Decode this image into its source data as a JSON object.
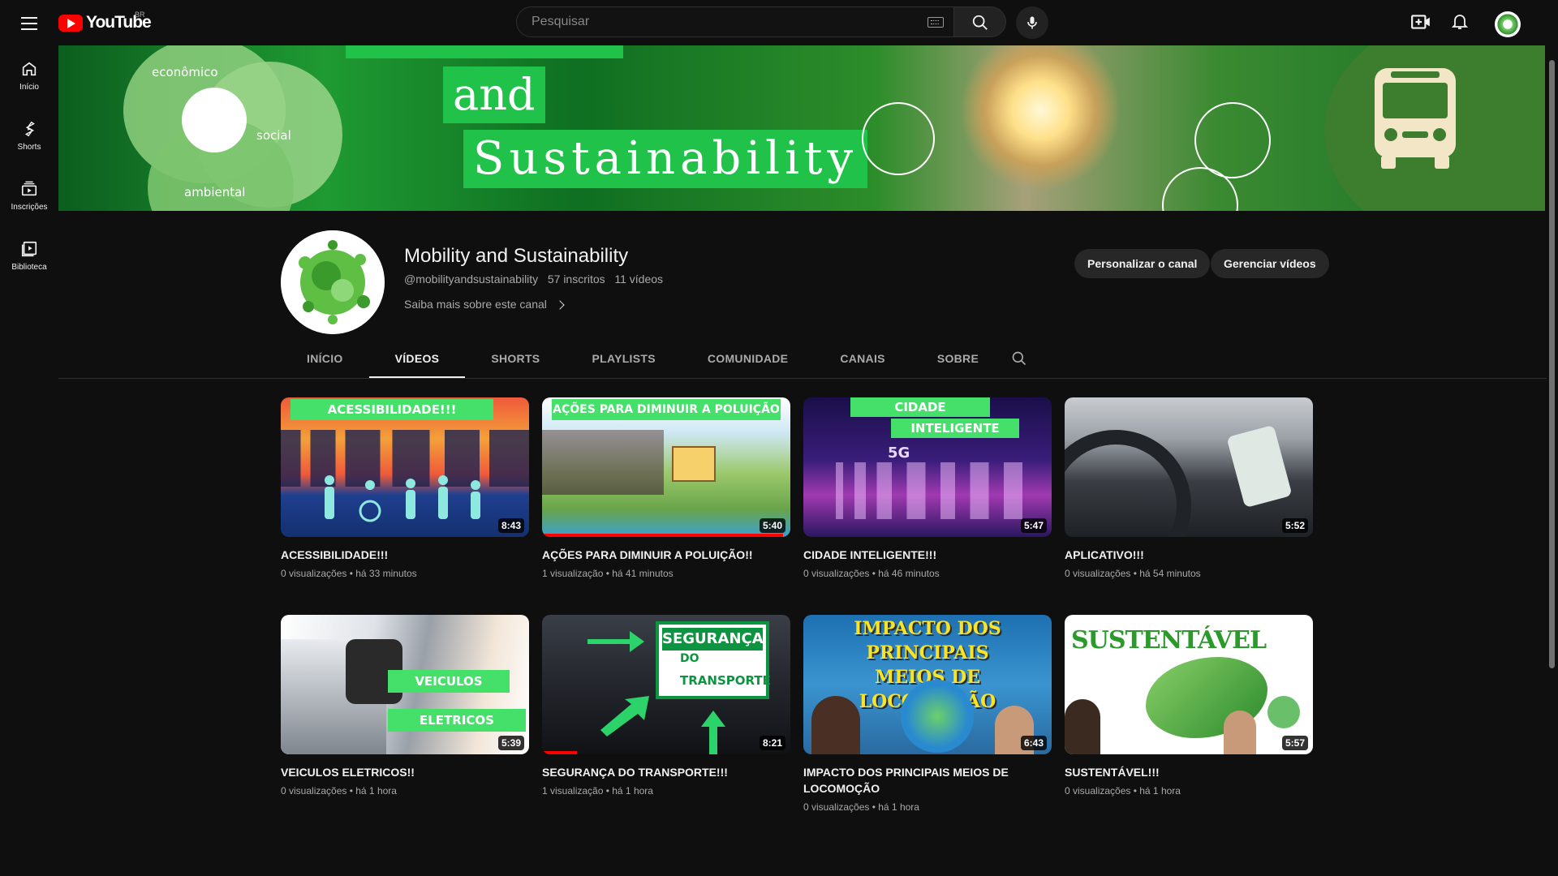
{
  "header": {
    "logo_text": "YouTube",
    "country_code": "BR",
    "search_placeholder": "Pesquisar"
  },
  "sidebar": {
    "items": [
      {
        "label": "Início",
        "icon": "home-icon"
      },
      {
        "label": "Shorts",
        "icon": "shorts-icon"
      },
      {
        "label": "Inscrições",
        "icon": "subscriptions-icon"
      },
      {
        "label": "Biblioteca",
        "icon": "library-icon"
      }
    ]
  },
  "banner": {
    "words": [
      "and",
      "Sustainability"
    ],
    "circle_labels": [
      "econômico",
      "social",
      "ambiental"
    ]
  },
  "channel": {
    "name": "Mobility and Sustainability",
    "handle": "@mobilityandsustainability",
    "subscribers": "57 inscritos",
    "video_count": "11 vídeos",
    "more_link": "Saiba mais sobre este canal",
    "customize_button": "Personalizar o canal",
    "manage_button": "Gerenciar vídeos"
  },
  "tabs": [
    "INÍCIO",
    "VÍDEOS",
    "SHORTS",
    "PLAYLISTS",
    "COMUNIDADE",
    "CANAIS",
    "SOBRE"
  ],
  "active_tab": "VÍDEOS",
  "videos": [
    {
      "title": "ACESSIBILIDADE!!!",
      "views": "0 visualizações",
      "age": "há 33 minutos",
      "duration": "8:43",
      "thumb_text": "ACESSIBILIDADE!!!"
    },
    {
      "title": "AÇÕES PARA DIMINUIR A POLUIÇÃO!!",
      "views": "1 visualização",
      "age": "há 41 minutos",
      "duration": "5:40",
      "thumb_text": "AÇÕES PARA DIMINUIR A POLUIÇÃO",
      "progress": 0.97
    },
    {
      "title": "CIDADE INTELIGENTE!!!",
      "views": "0 visualizações",
      "age": "há 46 minutos",
      "duration": "5:47",
      "thumb_text": [
        "CIDADE",
        "INTELIGENTE",
        "5G"
      ]
    },
    {
      "title": "APLICATIVO!!!",
      "views": "0 visualizações",
      "age": "há 54 minutos",
      "duration": "5:52"
    },
    {
      "title": "VEICULOS ELETRICOS!!",
      "views": "0 visualizações",
      "age": "há 1 hora",
      "duration": "5:39",
      "thumb_text": [
        "VEICULOS",
        "ELETRICOS"
      ]
    },
    {
      "title": "SEGURANÇA DO TRANSPORTE!!!",
      "views": "1 visualização",
      "age": "há 1 hora",
      "duration": "8:21",
      "thumb_text": [
        "SEGURANÇA",
        "DO",
        "TRANSPORTE"
      ],
      "progress": 0.14
    },
    {
      "title": "IMPACTO DOS PRINCIPAIS MEIOS DE LOCOMOÇÃO",
      "views": "0 visualizações",
      "age": "há 1 hora",
      "duration": "6:43",
      "thumb_text": [
        "IMPACTO DOS PRINCIPAIS",
        "MEIOS DE LOCOMOÇÃO"
      ]
    },
    {
      "title": "SUSTENTÁVEL!!!",
      "views": "0 visualizações",
      "age": "há 1 hora",
      "duration": "5:57",
      "thumb_text": "SUSTENTÁVEL"
    }
  ],
  "colors": {
    "background": "#0f0f0f",
    "accent_red": "#ff0000",
    "banner_green": "#21c24a"
  }
}
